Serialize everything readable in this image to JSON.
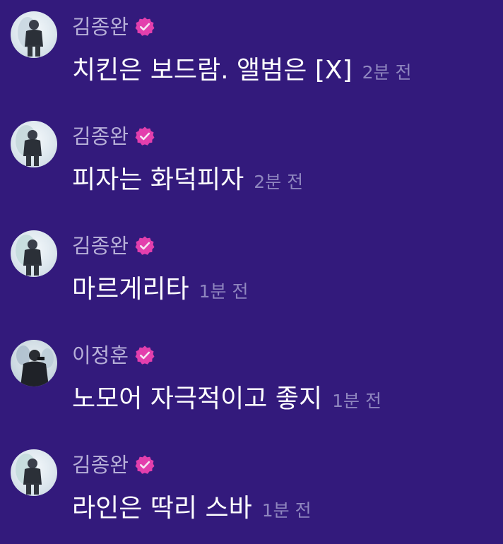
{
  "colors": {
    "background": "#331a7c",
    "sender_name": "#b7b0d8",
    "message_text": "#ffffff",
    "timestamp": "#8f86bf",
    "verified_badge": "#e33fad"
  },
  "messages": [
    {
      "sender": "김종완",
      "text": "치킨은 보드람. 앨범은 [X]",
      "time": "2분 전",
      "verified": true,
      "avatar_icon": "person-photo-icon"
    },
    {
      "sender": "김종완",
      "text": "피자는 화덕피자",
      "time": "2분 전",
      "verified": true,
      "avatar_icon": "person-photo-icon"
    },
    {
      "sender": "김종완",
      "text": "마르게리타",
      "time": "1분 전",
      "verified": true,
      "avatar_icon": "person-photo-icon"
    },
    {
      "sender": "이정훈",
      "text": "노모어 자극적이고 좋지",
      "time": "1분 전",
      "verified": true,
      "avatar_icon": "person-photo-icon"
    },
    {
      "sender": "김종완",
      "text": "라인은 딱리 스바",
      "time": "1분 전",
      "verified": true,
      "avatar_icon": "person-photo-icon"
    }
  ]
}
